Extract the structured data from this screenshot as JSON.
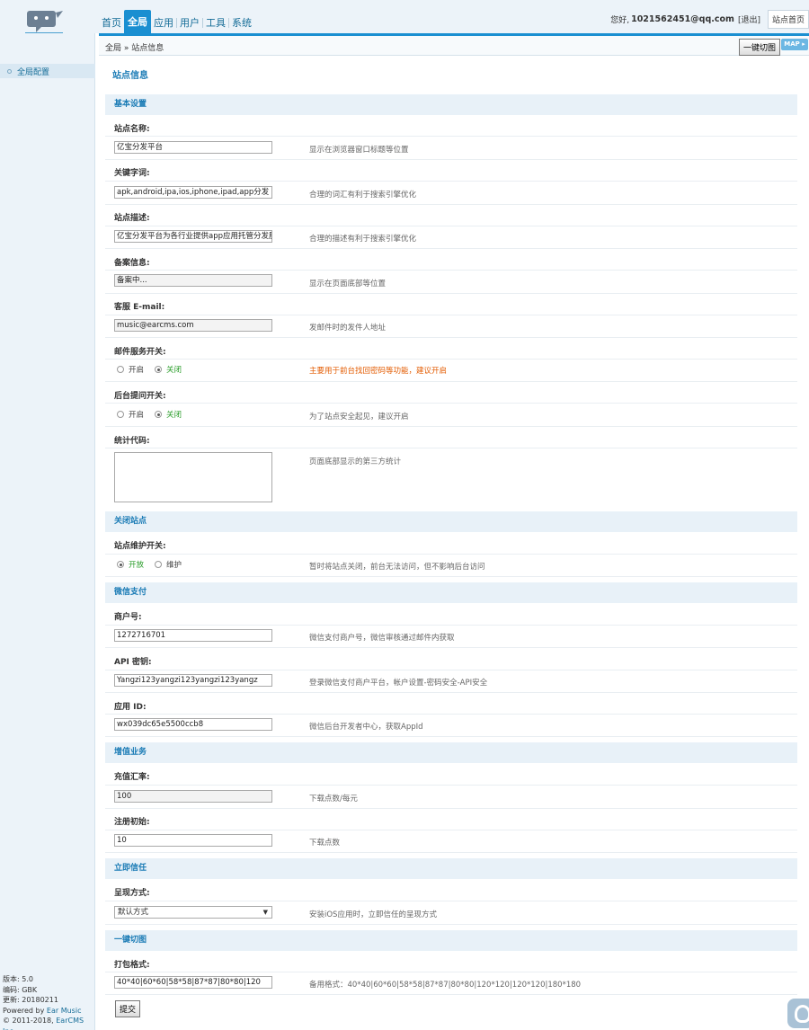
{
  "header": {
    "nav": [
      "首页",
      "全局",
      "应用",
      "用户",
      "工具",
      "系统"
    ],
    "active_nav": "全局",
    "greeting": "您好,",
    "email": "1021562451@qq.com",
    "logout": "[退出]",
    "site_home": "站点首页"
  },
  "sidebar": {
    "items": [
      {
        "label": "全局配置"
      }
    ],
    "version_info": [
      "版本: 5.0",
      "编码: GBK",
      "更新: 20180211"
    ],
    "powered_prefix": "Powered by ",
    "powered_link": "Ear Music",
    "copyright_prefix": "© 2011-2018, ",
    "copyright_link": "EarCMS Inc."
  },
  "breadcrumb": "全局 » 站点信息",
  "onekey_button": "一键切图",
  "map_button": "MAP ▸",
  "page_title": "站点信息",
  "sections": {
    "basic": "基本设置",
    "close": "关闭站点",
    "wechat": "微信支付",
    "value": "增值业务",
    "trust": "立即信任",
    "cut": "一键切图"
  },
  "fields": {
    "site_name": {
      "label": "站点名称:",
      "value": "亿宝分发平台",
      "hint": "显示在浏览器窗口标题等位置"
    },
    "keywords": {
      "label": "关键字词:",
      "value": "apk,android,ipa,ios,iphone,ipad,app分发",
      "hint": "合理的词汇有利于搜索引擎优化"
    },
    "description": {
      "label": "站点描述:",
      "value": "亿宝分发平台为各行业提供app应用托管分发服",
      "hint": "合理的描述有利于搜索引擎优化"
    },
    "icp": {
      "label": "备案信息:",
      "value": "备案中...",
      "hint": "显示在页面底部等位置"
    },
    "email": {
      "label": "客服 E-mail:",
      "value": "music@earcms.com",
      "hint": "发邮件时的发件人地址"
    },
    "mail_switch": {
      "label": "邮件服务开关:",
      "on": "开启",
      "off": "关闭",
      "selected": "off",
      "hint": "主要用于前台找回密码等功能，建议开启"
    },
    "admin_question": {
      "label": "后台提问开关:",
      "on": "开启",
      "off": "关闭",
      "selected": "off",
      "hint": "为了站点安全起见，建议开启"
    },
    "stat_code": {
      "label": "统计代码:",
      "value": "",
      "hint": "页面底部显示的第三方统计"
    },
    "maintenance": {
      "label": "站点维护开关:",
      "on": "开放",
      "off": "维护",
      "selected": "on",
      "hint": "暂时将站点关闭，前台无法访问，但不影响后台访问"
    },
    "mch_id": {
      "label": "商户号:",
      "value": "1272716701",
      "hint": "微信支付商户号，微信审核通过邮件内获取"
    },
    "api_key": {
      "label": "API 密钥:",
      "value": "Yangzi123yangzi123yangzi123yangz",
      "hint": "登录微信支付商户平台，帐户设置-密码安全-API安全"
    },
    "app_id": {
      "label": "应用 ID:",
      "value": "wx039dc65e5500ccb8",
      "hint": "微信后台开发者中心，获取AppId"
    },
    "rate": {
      "label": "充值汇率:",
      "value": "100",
      "hint": "下载点数/每元"
    },
    "register_bonus": {
      "label": "注册初始:",
      "value": "10",
      "hint": "下载点数"
    },
    "present_mode": {
      "label": "呈现方式:",
      "value": "默认方式",
      "hint": "安装iOS应用时，立即信任的呈现方式"
    },
    "cut_format": {
      "label": "打包格式:",
      "value": "40*40|60*60|58*58|87*87|80*80|120",
      "hint": "备用格式：40*40|60*60|58*58|87*87|80*80|120*120|120*120|180*180"
    }
  },
  "submit_button": "提交",
  "colors": {
    "accent": "#1a8fd1",
    "section_bg": "#e8f1f8",
    "warn": "#e35b00"
  }
}
